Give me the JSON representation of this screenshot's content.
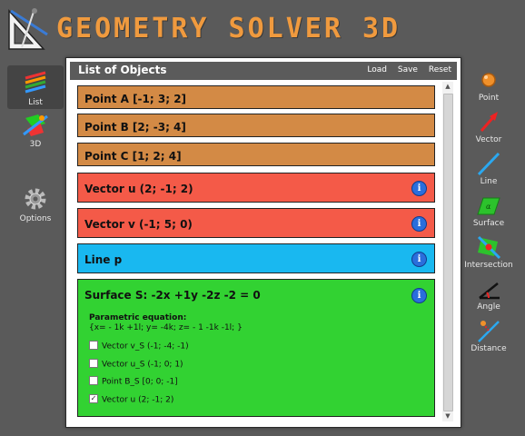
{
  "app": {
    "title": "GEOMETRY SOLVER 3D"
  },
  "left_nav": [
    {
      "label": "List",
      "icon": "list-icon",
      "active": true
    },
    {
      "label": "3D",
      "icon": "3d-icon",
      "active": false
    },
    {
      "label": "Options",
      "icon": "gear-icon",
      "active": false
    }
  ],
  "panel": {
    "title": "List of Objects",
    "actions": [
      "Load",
      "Save",
      "Reset"
    ]
  },
  "objects": [
    {
      "type": "point",
      "label": "Point A [-1; 3; 2]",
      "color": "#d38a45"
    },
    {
      "type": "point",
      "label": "Point B [2; -3; 4]",
      "color": "#d38a45"
    },
    {
      "type": "point",
      "label": "Point C [1; 2; 4]",
      "color": "#d38a45"
    },
    {
      "type": "vector",
      "label": "Vector u (2; -1; 2)",
      "color": "#f45a48",
      "info": "i"
    },
    {
      "type": "vector",
      "label": "Vector v (-1; 5; 0)",
      "color": "#f45a48",
      "info": "i"
    },
    {
      "type": "line",
      "label": "Line p",
      "color": "#19b8f0",
      "info": "i"
    },
    {
      "type": "surface",
      "label": "Surface S: -2x +1y -2z -2 = 0",
      "color": "#32d232",
      "info": "i",
      "param_label": "Parametric equation:",
      "param_eq": "{x= - 1k +1l; y= -4k; z= - 1 -1k -1l; }",
      "options": [
        {
          "label": "Vector v_S (-1; -4; -1)",
          "checked": false
        },
        {
          "label": "Vector u_S (-1; 0; 1)",
          "checked": false
        },
        {
          "label": "Point B_S [0; 0; -1]",
          "checked": false
        },
        {
          "label": "Vector u (2; -1; 2)",
          "checked": true
        }
      ]
    }
  ],
  "tools": [
    {
      "label": "Point",
      "icon": "point-icon"
    },
    {
      "label": "Vector",
      "icon": "vector-icon"
    },
    {
      "label": "Line",
      "icon": "line-icon"
    },
    {
      "label": "Surface",
      "icon": "surface-icon"
    },
    {
      "label": "Intersection",
      "icon": "intersection-icon"
    },
    {
      "label": "Angle",
      "icon": "angle-icon"
    },
    {
      "label": "Distance",
      "icon": "distance-icon"
    }
  ],
  "colors": {
    "title": "#f09a3e",
    "point": "#d38a45",
    "vector": "#f45a48",
    "line": "#19b8f0",
    "surface": "#32d232",
    "info": "#2a6edc"
  }
}
